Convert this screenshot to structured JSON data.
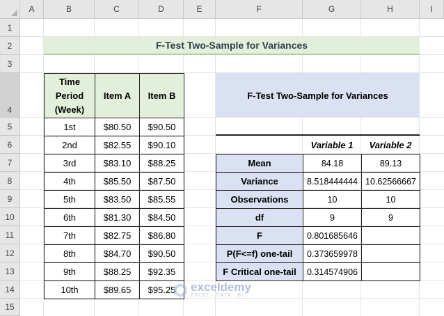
{
  "columns": [
    "A",
    "B",
    "C",
    "D",
    "E",
    "F",
    "G",
    "H",
    "I"
  ],
  "rows": [
    "1",
    "2",
    "3",
    "4",
    "5",
    "6",
    "7",
    "8",
    "9",
    "10",
    "11",
    "12",
    "13",
    "14",
    "15"
  ],
  "title": "F-Test Two-Sample for Variances",
  "data_table": {
    "headers": [
      "Time Period (Week)",
      "Item A",
      "Item B"
    ],
    "rows": [
      [
        "1st",
        "$80.50",
        "$90.50"
      ],
      [
        "2nd",
        "$82.55",
        "$90.10"
      ],
      [
        "3rd",
        "$83.10",
        "$88.25"
      ],
      [
        "4th",
        "$85.50",
        "$87.50"
      ],
      [
        "5th",
        "$83.50",
        "$85.55"
      ],
      [
        "6th",
        "$81.30",
        "$84.50"
      ],
      [
        "7th",
        "$82.75",
        "$86.80"
      ],
      [
        "8th",
        "$84.70",
        "$90.50"
      ],
      [
        "9th",
        "$88.25",
        "$92.35"
      ],
      [
        "10th",
        "$89.65",
        "$95.25"
      ]
    ]
  },
  "result_title": "F-Test Two-Sample for Variances",
  "var_headers": [
    "Variable 1",
    "Variable 2"
  ],
  "results": [
    [
      "Mean",
      "84.18",
      "89.13"
    ],
    [
      "Variance",
      "8.518444444",
      "10.62566667"
    ],
    [
      "Observations",
      "10",
      "10"
    ],
    [
      "df",
      "9",
      "9"
    ],
    [
      "F",
      "0.801685646",
      ""
    ],
    [
      "P(F<=f) one-tail",
      "0.373659978",
      ""
    ],
    [
      "F Critical one-tail",
      "0.314574906",
      ""
    ]
  ],
  "watermark": {
    "name": "exceldemy",
    "sub": "EXCEL · DATA · BI"
  }
}
